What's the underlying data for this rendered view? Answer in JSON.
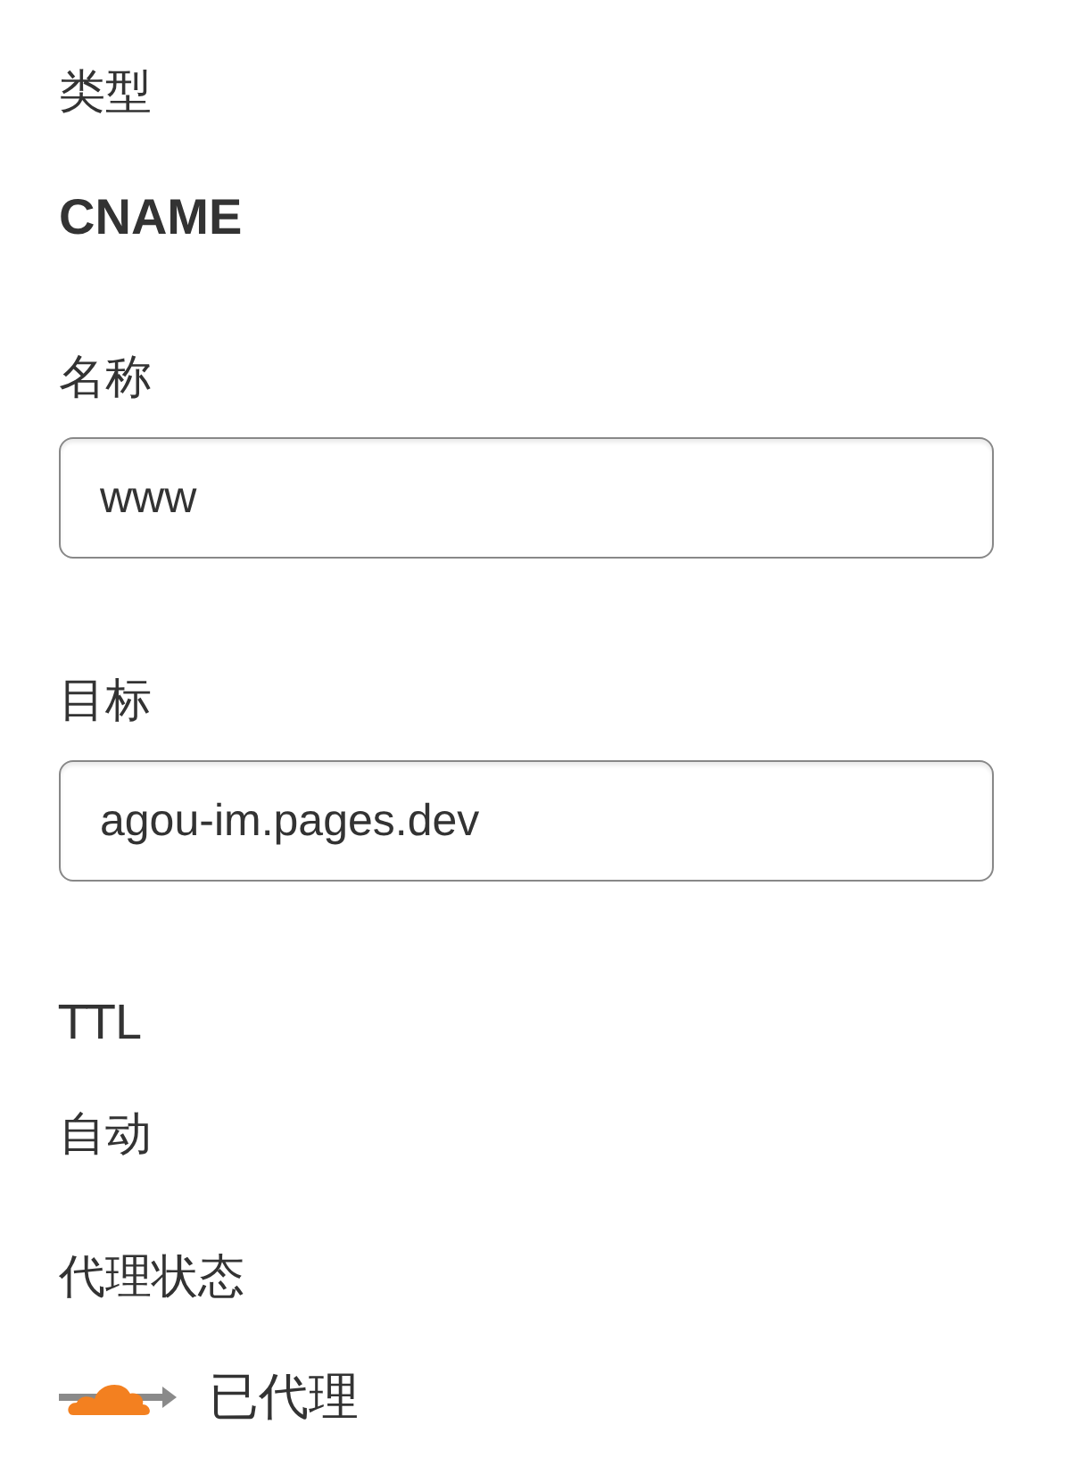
{
  "fields": [
    {
      "kind": "strong",
      "label": "类型",
      "value": "CNAME"
    },
    {
      "kind": "input",
      "label": "名称",
      "value": "www"
    },
    {
      "kind": "input",
      "label": "目标",
      "value": "agou-im.pages.dev"
    },
    {
      "kind": "text",
      "label": "TTL",
      "value": "自动"
    },
    {
      "kind": "proxy",
      "label": "代理状态",
      "value": "已代理",
      "proxied": true
    }
  ]
}
